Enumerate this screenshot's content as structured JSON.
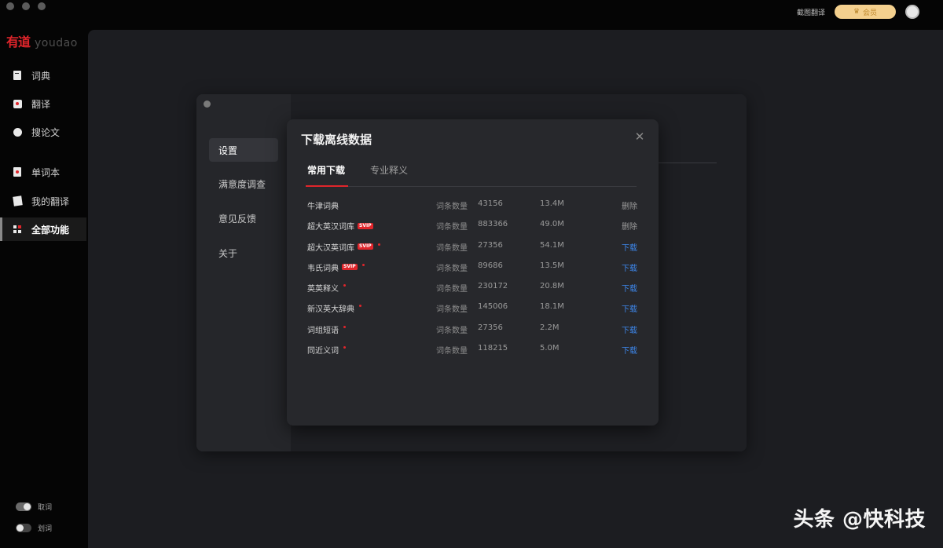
{
  "topbar": {
    "screenshot_translate": "截图翻译",
    "vip_label": "会员",
    "vip_icon": "crown-icon"
  },
  "sidebar": {
    "logo_cn": "有道",
    "logo_en": "youdao",
    "items": [
      {
        "label": "词典",
        "icon": "dictionary-icon"
      },
      {
        "label": "翻译",
        "icon": "translate-icon"
      },
      {
        "label": "搜论文",
        "icon": "paper-search-icon"
      },
      {
        "label": "单词本",
        "icon": "wordbook-icon"
      },
      {
        "label": "我的翻译",
        "icon": "my-translation-icon"
      },
      {
        "label": "全部功能",
        "icon": "all-features-icon"
      }
    ],
    "toggles": [
      {
        "label": "取词",
        "state": "on"
      },
      {
        "label": "划词",
        "state": "off"
      }
    ]
  },
  "settings": {
    "nav": [
      {
        "label": "设置"
      },
      {
        "label": "满意度调查"
      },
      {
        "label": "意见反馈"
      },
      {
        "label": "关于"
      }
    ]
  },
  "download_modal": {
    "title": "下载离线数据",
    "close_icon": "close-icon",
    "tabs": [
      {
        "label": "常用下载",
        "active": true
      },
      {
        "label": "专业释义",
        "active": false
      }
    ],
    "count_label": "词条数量",
    "vip_tag": "SVIP",
    "rows": [
      {
        "name": "牛津词典",
        "vip": false,
        "dot": false,
        "count": "43156",
        "size": "13.4M",
        "action": "删除",
        "action_type": "delete"
      },
      {
        "name": "超大英汉词库",
        "vip": true,
        "dot": false,
        "count": "883366",
        "size": "49.0M",
        "action": "删除",
        "action_type": "delete"
      },
      {
        "name": "超大汉英词库",
        "vip": true,
        "dot": true,
        "count": "27356",
        "size": "54.1M",
        "action": "下载",
        "action_type": "download"
      },
      {
        "name": "韦氏词典",
        "vip": true,
        "dot": true,
        "count": "89686",
        "size": "13.5M",
        "action": "下载",
        "action_type": "download"
      },
      {
        "name": "英英释义",
        "vip": false,
        "dot": true,
        "count": "230172",
        "size": "20.8M",
        "action": "下载",
        "action_type": "download"
      },
      {
        "name": "新汉英大辞典",
        "vip": false,
        "dot": true,
        "count": "145006",
        "size": "18.1M",
        "action": "下载",
        "action_type": "download"
      },
      {
        "name": "词组短语",
        "vip": false,
        "dot": true,
        "count": "27356",
        "size": "2.2M",
        "action": "下载",
        "action_type": "download"
      },
      {
        "name": "同近义词",
        "vip": false,
        "dot": true,
        "count": "118215",
        "size": "5.0M",
        "action": "下载",
        "action_type": "download"
      }
    ]
  },
  "watermark": "头条 @快科技",
  "colors": {
    "accent_red": "#e0252b",
    "link_blue": "#3d86ea",
    "vip_gold": "#f4d08e"
  }
}
